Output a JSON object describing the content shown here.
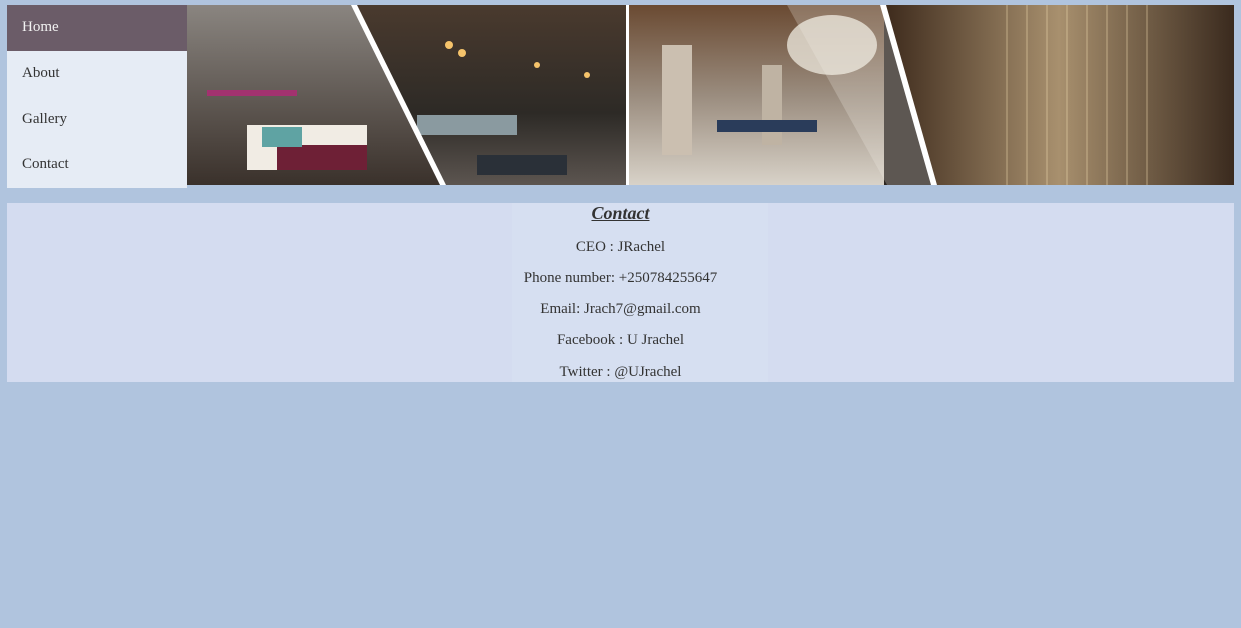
{
  "nav": {
    "items": [
      {
        "label": "Home",
        "active": true
      },
      {
        "label": "About",
        "active": false
      },
      {
        "label": "Gallery",
        "active": false
      },
      {
        "label": "Contact",
        "active": false
      }
    ]
  },
  "contact": {
    "title": "Contact",
    "lines": [
      "CEO : JRachel",
      "Phone number: +250784255647",
      "Email: Jrach7@gmail.com",
      "Facebook : U Jrachel",
      "Twitter : @UJrachel"
    ]
  },
  "colors": {
    "page_background": "#b0c4de",
    "nav_background": "#e6ecf5",
    "nav_active": "#6b5c68",
    "contact_background": "#d4dcf0"
  }
}
